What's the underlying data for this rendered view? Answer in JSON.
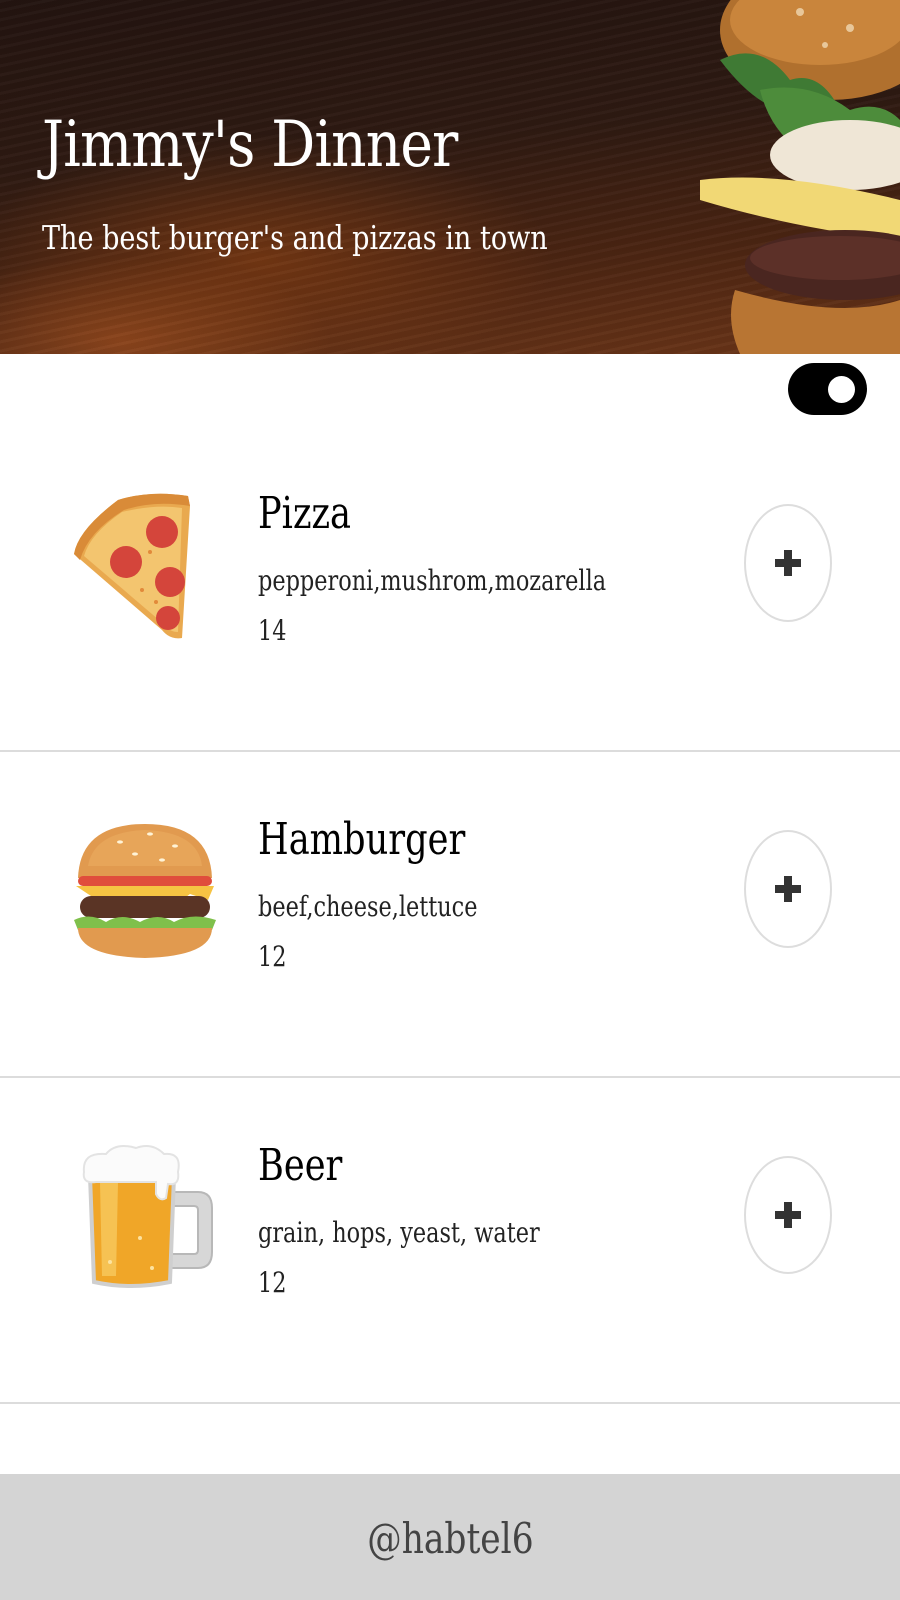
{
  "header": {
    "title": "Jimmy's Dinner",
    "subtitle": "The best burger's and pizzas in town"
  },
  "theme_toggle": {
    "state": "on"
  },
  "menu": {
    "items": [
      {
        "name": "Pizza",
        "ingredients": "pepperoni,mushrom,mozarella",
        "price": "14",
        "icon": "pizza-icon",
        "add_icon": "plus-icon"
      },
      {
        "name": "Hamburger",
        "ingredients": "beef,cheese,lettuce",
        "price": "12",
        "icon": "hamburger-icon",
        "add_icon": "plus-icon"
      },
      {
        "name": "Beer",
        "ingredients": "grain, hops, yeast, water",
        "price": "12",
        "icon": "beer-mug-icon",
        "add_icon": "plus-icon"
      }
    ]
  },
  "footer": {
    "text": "@habtel6"
  },
  "colors": {
    "toggle": "#000000",
    "divider": "#dcdcdc",
    "footer_bg": "#d4d4d4",
    "add_button_border": "#dddddd"
  }
}
